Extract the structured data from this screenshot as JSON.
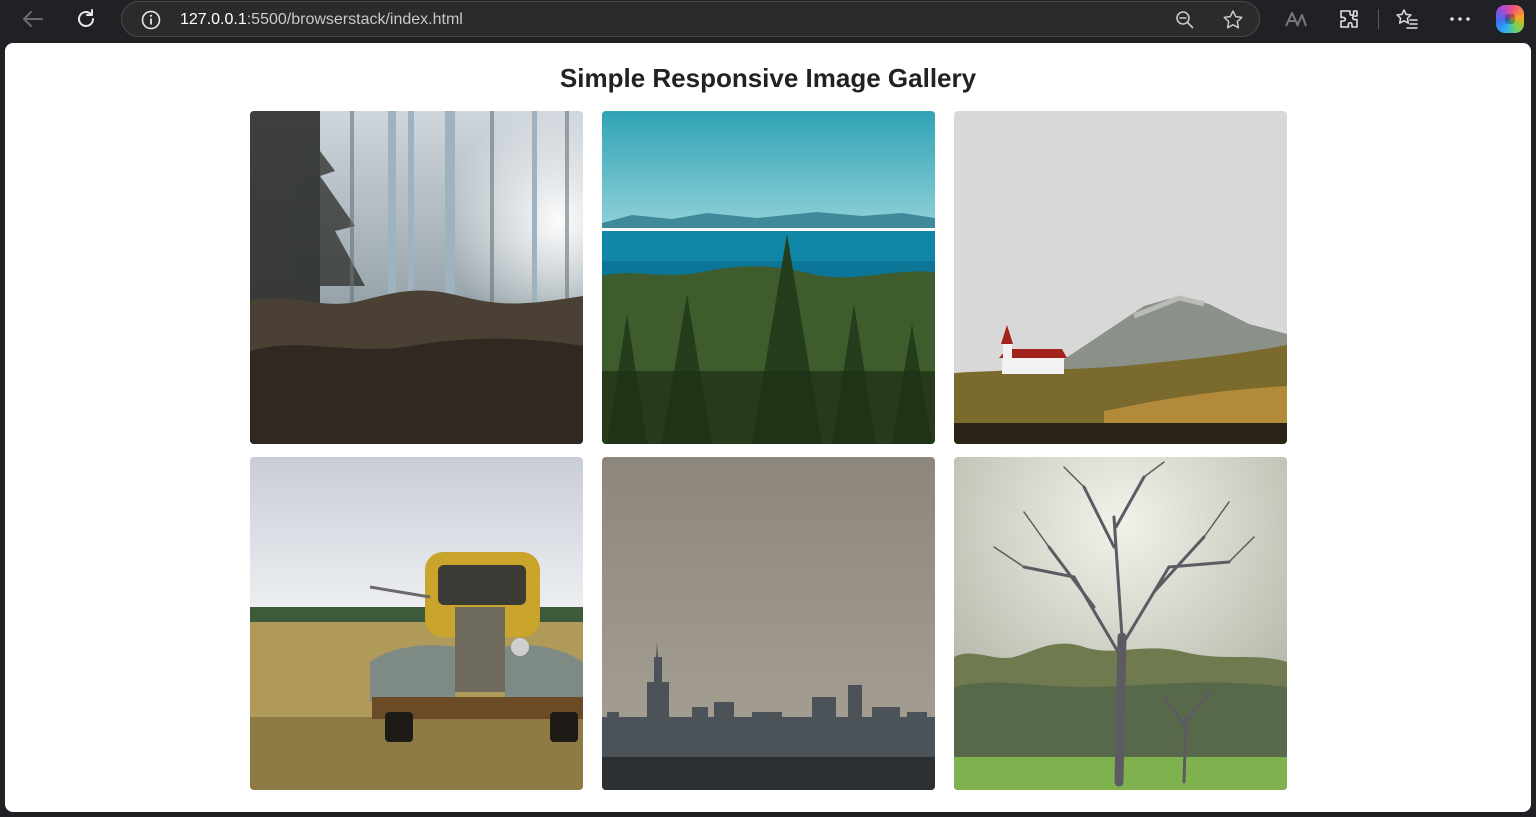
{
  "browser": {
    "url_host": "127.0.0.1",
    "url_rest": ":5500/browserstack/index.html",
    "icons": [
      "back-arrow-icon",
      "reload-icon",
      "site-info-icon",
      "zoom-out-icon",
      "favorite-star-icon",
      "read-aloud-icon",
      "extensions-icon",
      "favorites-list-icon",
      "more-icon",
      "copilot-icon"
    ]
  },
  "page": {
    "title": "Simple Responsive Image Gallery"
  },
  "gallery": {
    "images": [
      {
        "name": "misty-forest-image",
        "subject": "foggy forest with sun rays"
      },
      {
        "name": "lake-pines-image",
        "subject": "pine trees in front of blue lake and hills"
      },
      {
        "name": "church-mountain-image",
        "subject": "red-roofed church below a mountain"
      },
      {
        "name": "rusty-truck-image",
        "subject": "rusty vintage truck in a field"
      },
      {
        "name": "city-skyline-image",
        "subject": "city skyline under grey sky"
      },
      {
        "name": "bare-tree-image",
        "subject": "large leafless tree in a park"
      }
    ]
  }
}
